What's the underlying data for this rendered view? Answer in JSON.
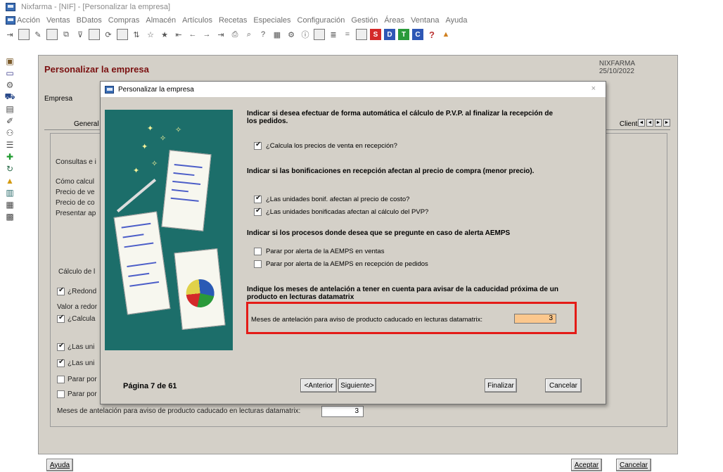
{
  "window": {
    "title": "Nixfarma - [NIF] - [Personalizar la empresa]"
  },
  "menu": [
    "Acción",
    "Ventas",
    "BDatos",
    "Compras",
    "Almacén",
    "Artículos",
    "Recetas",
    "Especiales",
    "Configuración",
    "Gestión",
    "Áreas",
    "Ventana",
    "Ayuda"
  ],
  "toolbar": {
    "letter_buttons": [
      "S",
      "D",
      "T",
      "C"
    ],
    "help": "?"
  },
  "main": {
    "title": "Personalizar la empresa",
    "company_name": "NIXFARMA",
    "date": "25/10/2022",
    "empresa_label": "Empresa",
    "tab_general": "General",
    "tab_clientes": "Clientes",
    "bg_lines": {
      "consultas": "Consultas e i",
      "como_calcular": "Cómo calcul",
      "precio_venta": "Precio de ve",
      "precio_coste": "Precio de co",
      "presentar": "Presentar ap",
      "calculo": "Cálculo de l",
      "redondear": "¿Redond",
      "valor_redondeo": "Valor a redor",
      "calcular": "¿Calcula",
      "las_uni_1": "¿Las uni",
      "las_uni_2": "¿Las uni",
      "parar_1": "Parar por",
      "parar_2": "Parar por"
    },
    "meses_label": "Meses de antelación para aviso de producto caducado en lecturas datamatrix:",
    "meses_value": "3",
    "ayuda_button": "Ayuda",
    "aceptar_button": "Aceptar",
    "cancelar_button": "Cancelar"
  },
  "dialog": {
    "title": "Personalizar la empresa",
    "close": "×",
    "section1": "Indicar si desea efectuar de forma automática el cálculo de P.V.P. al finalizar la recepción de los pedidos.",
    "opt_calcula": {
      "label": "¿Calcula los precios de venta en recepción?",
      "checked": true
    },
    "section2": "Indicar si las bonificaciones en recepción afectan al precio de compra (menor precio).",
    "opt_unidades_bonif": {
      "label": "¿Las unidades bonif. afectan al precio de costo?",
      "checked": true
    },
    "opt_unidades_bonificadas": {
      "label": "¿Las unidades bonificadas afectan al cálculo del PVP?",
      "checked": true
    },
    "section3": "Indicar si los procesos donde desea que se pregunte en caso de alerta AEMPS",
    "opt_parar_ventas": {
      "label": "Parar por alerta de la AEMPS en ventas",
      "checked": false
    },
    "opt_parar_recepcion": {
      "label": "Parar por alerta de la AEMPS en recepción de pedidos",
      "checked": false
    },
    "section4": "Indique los meses de antelación a tener en cuenta para avisar de la caducidad próxima de un producto en lecturas datamatrix",
    "meses_label": "Meses de antelación para aviso de producto caducado en lecturas datamatrix:",
    "meses_value": "3",
    "pagina": "Página 7 de 61",
    "anterior": "<Anterior",
    "siguiente": "Siguiente>",
    "finalizar": "Finalizar",
    "cancelar": "Cancelar"
  },
  "colors": {
    "panel_bg": "#d4d0c8",
    "title_red": "#7a1010",
    "illustration_bg": "#1c6e6a",
    "field_highlight": "#fbc78d",
    "annotation_red": "#e41b17"
  }
}
